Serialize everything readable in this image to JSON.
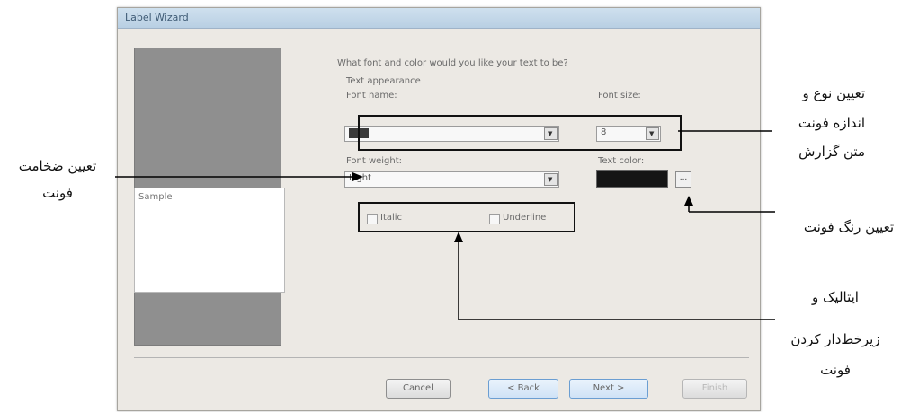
{
  "dialog": {
    "title": "Label Wizard",
    "question": "What font and color would you like your text to be?",
    "section_label": "Text appearance",
    "font_name_label": "Font name:",
    "font_size_label": "Font size:",
    "font_size_value": "8",
    "font_weight_label": "Font weight:",
    "font_weight_value": "Light",
    "text_color_label": "Text color:",
    "text_color_value": "#151515",
    "ellipsis_label": "...",
    "italic_label": "Italic",
    "underline_label": "Underline",
    "sample_label": "Sample",
    "buttons": {
      "cancel": "Cancel",
      "back": "< Back",
      "next": "Next >",
      "finish": "Finish"
    }
  },
  "annotations": {
    "font_type_size": [
      "تعیین نوع و",
      "اندازه فونت",
      "متن گزارش"
    ],
    "font_weight": [
      "تعیین ضخامت",
      "فونت"
    ],
    "font_color": "تعیین رنگ فونت",
    "italic_underline": [
      "ایتالیک و",
      "زیرخط‌دار کردن",
      "فونت"
    ]
  }
}
